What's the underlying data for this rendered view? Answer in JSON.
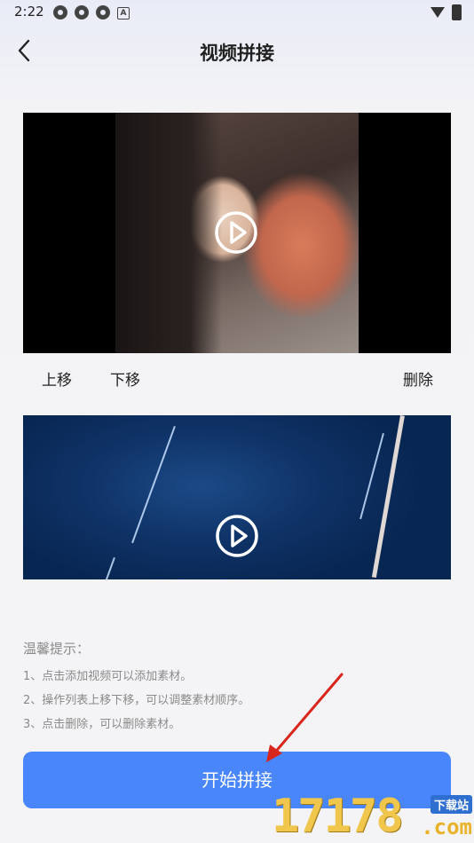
{
  "status_bar": {
    "time": "2:22"
  },
  "header": {
    "title": "视频拼接"
  },
  "videos": [
    {
      "alt": "portrait video clip"
    },
    {
      "alt": "blue streak video clip"
    }
  ],
  "actions": {
    "move_up": "上移",
    "move_down": "下移",
    "delete": "删除"
  },
  "tips": {
    "title": "温馨提示：",
    "lines": [
      "1、点击添加视频可以添加素材。",
      "2、操作列表上移下移，可以调整素材顺序。",
      "3、点击删除，可以删除素材。"
    ]
  },
  "start_button": {
    "label": "开始拼接"
  },
  "watermark": {
    "digits": "17178",
    "tag": "下载站",
    "suffix": ".com"
  },
  "colors": {
    "accent": "#4a86fb",
    "arrow": "#d9261c"
  }
}
